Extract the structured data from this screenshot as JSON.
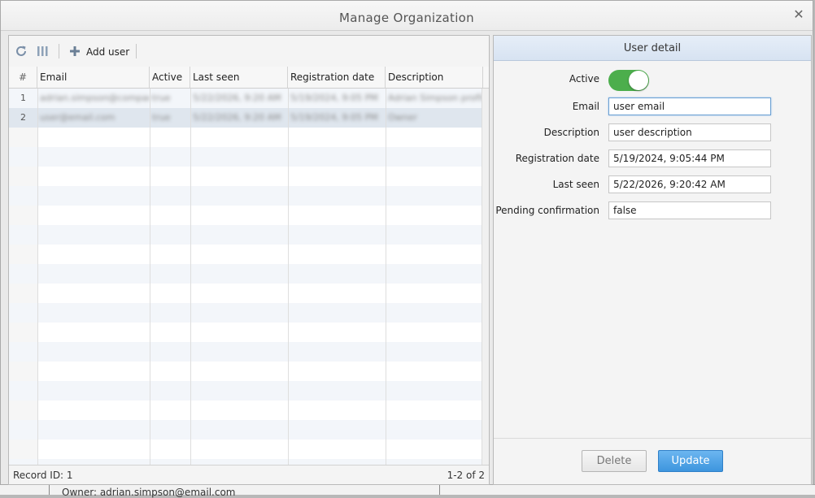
{
  "dialog": {
    "title": "Manage Organization",
    "close_glyph": "✕"
  },
  "underlay": {
    "text": "Owner: adrian.simpson@email.com"
  },
  "toolbar": {
    "refresh_icon": "refresh-icon",
    "columns_icon": "columns-icon",
    "add_user_label": "Add user"
  },
  "grid": {
    "columns": [
      "#",
      "Email",
      "Active",
      "Last seen",
      "Registration date",
      "Description"
    ],
    "rows": [
      {
        "num": "1",
        "email": "adrian.simpson@company",
        "active": "true",
        "last_seen": "5/22/2026, 9:20 AM",
        "registration": "5/19/2024, 9:05 PM",
        "description": "Adrian Simpson profile"
      },
      {
        "num": "2",
        "email": "user@email.com",
        "active": "true",
        "last_seen": "5/22/2026, 9:20 AM",
        "registration": "5/19/2024, 9:05 PM",
        "description": "Owner"
      }
    ],
    "footer_left": "Record ID: 1",
    "footer_right": "1-2 of 2"
  },
  "detail": {
    "title": "User detail",
    "active_label": "Active",
    "active_value": true,
    "fields": [
      {
        "label": "Email",
        "value": "user email"
      },
      {
        "label": "Description",
        "value": "user description"
      },
      {
        "label": "Registration date",
        "value": "5/19/2024, 9:05:44 PM"
      },
      {
        "label": "Last seen",
        "value": "5/22/2026, 9:20:42 AM"
      },
      {
        "label": "Pending confirmation",
        "value": "false"
      }
    ],
    "delete_label": "Delete",
    "update_label": "Update"
  },
  "colors": {
    "accent": "#3d95de",
    "toggle_on": "#4cae4c",
    "header_bar": "#d7e3f2"
  }
}
